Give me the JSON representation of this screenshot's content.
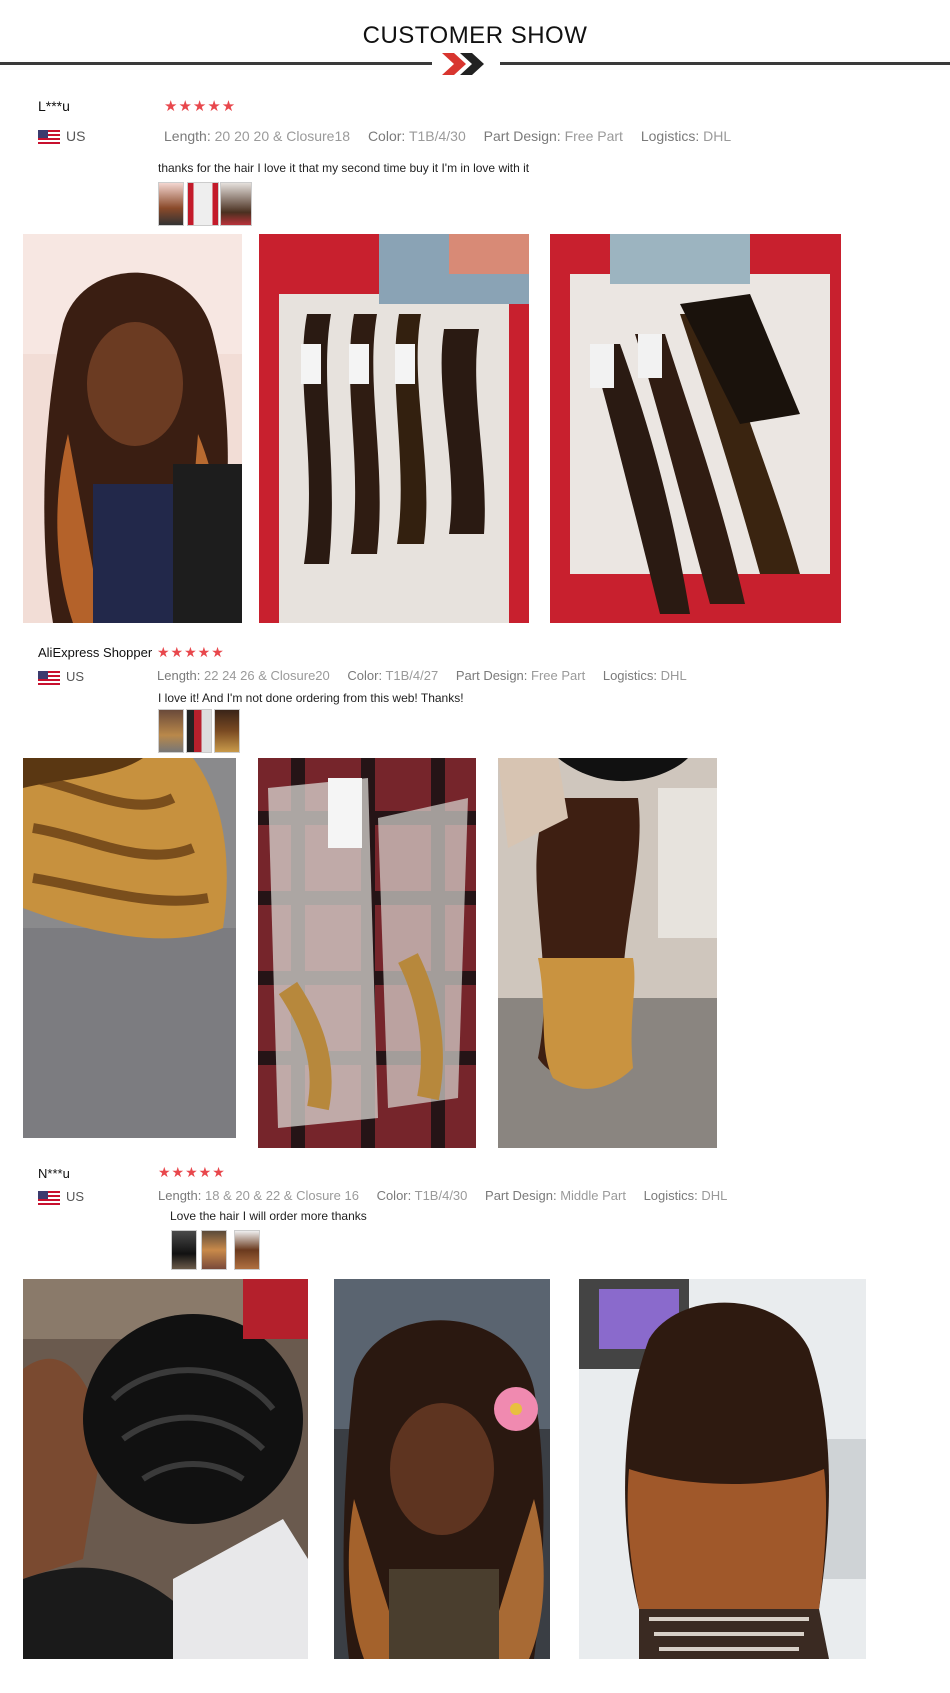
{
  "header": {
    "title": "CUSTOMER SHOW"
  },
  "colors": {
    "star": "#e8474c",
    "chevron_red": "#d8352f",
    "chevron_dark": "#222222",
    "rule": "#3a3a3a"
  },
  "reviews": [
    {
      "user": "L***u",
      "country": "US",
      "rating": 5,
      "stars": "★★★★★",
      "specs": {
        "length_label": "Length:",
        "length": "20 20 20 & Closure18",
        "color_label": "Color:",
        "color": "T1B/4/30",
        "part_label": "Part Design:",
        "part": "Free Part",
        "logistics_label": "Logistics:",
        "logistics": "DHL"
      },
      "comment": "thanks for the hair I love it that my second time buy it I'm in love with it"
    },
    {
      "user": "AliExpress Shopper",
      "country": "US",
      "rating": 5,
      "stars": "★★★★★",
      "specs": {
        "length_label": "Length:",
        "length": "22 24 26 & Closure20",
        "color_label": "Color:",
        "color": "T1B/4/27",
        "part_label": "Part Design:",
        "part": "Free Part",
        "logistics_label": "Logistics:",
        "logistics": "DHL"
      },
      "comment": "I love it! And I'm not done ordering from this web! Thanks!"
    },
    {
      "user": "N***u",
      "country": "US",
      "rating": 5,
      "stars": "★★★★★",
      "specs": {
        "length_label": "Length:",
        "length": "18 & 20 & 22 & Closure 16",
        "color_label": "Color:",
        "color": "T1B/4/30",
        "part_label": "Part Design:",
        "part": "Middle Part",
        "logistics_label": "Logistics:",
        "logistics": "DHL"
      },
      "comment": "Love the hair I will order more thanks"
    }
  ]
}
